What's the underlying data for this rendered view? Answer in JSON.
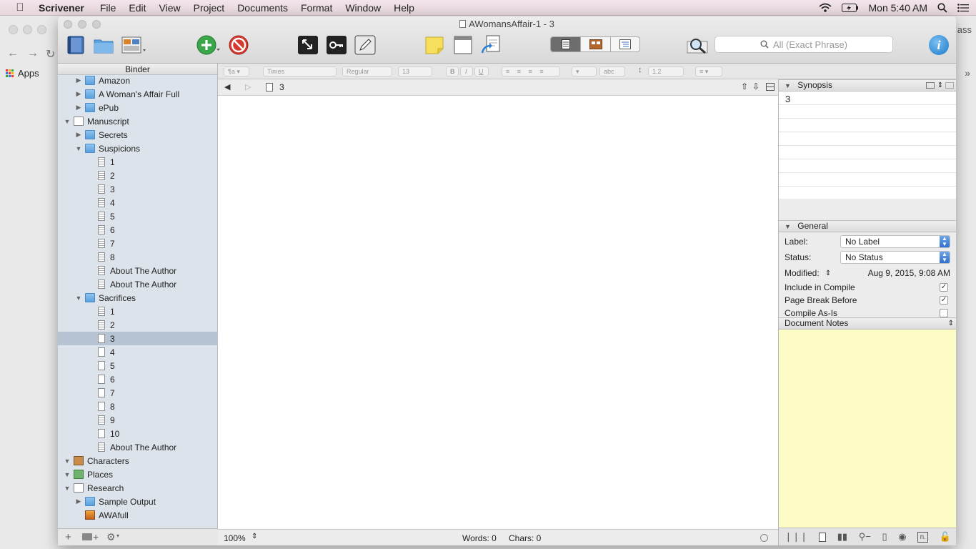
{
  "menubar": {
    "app_name": "Scrivener",
    "menus": [
      "File",
      "Edit",
      "View",
      "Project",
      "Documents",
      "Format",
      "Window",
      "Help"
    ],
    "clock": "Mon 5:40 AM"
  },
  "browser": {
    "apps_label": "Apps",
    "tab_fragment": "ass"
  },
  "window": {
    "title": "AWomansAffair-1 - 3",
    "search_placeholder": "All (Exact Phrase)"
  },
  "binder": {
    "header": "Binder",
    "items": [
      {
        "label": "Amazon",
        "level": 1,
        "icon": "folder",
        "tri": "right"
      },
      {
        "label": "A Woman's Affair Full",
        "level": 1,
        "icon": "folder",
        "tri": "right"
      },
      {
        "label": "ePub",
        "level": 1,
        "icon": "folder",
        "tri": "right"
      },
      {
        "label": "Manuscript",
        "level": 0,
        "icon": "ms",
        "tri": "down"
      },
      {
        "label": "Secrets",
        "level": 1,
        "icon": "folder",
        "tri": "right"
      },
      {
        "label": "Suspicions",
        "level": 1,
        "icon": "folder",
        "tri": "down"
      },
      {
        "label": "1",
        "level": 2,
        "icon": "doc"
      },
      {
        "label": "2",
        "level": 2,
        "icon": "doc"
      },
      {
        "label": "3",
        "level": 2,
        "icon": "doc"
      },
      {
        "label": "4",
        "level": 2,
        "icon": "doc"
      },
      {
        "label": "5",
        "level": 2,
        "icon": "doc"
      },
      {
        "label": "6",
        "level": 2,
        "icon": "doc"
      },
      {
        "label": "7",
        "level": 2,
        "icon": "doc"
      },
      {
        "label": "8",
        "level": 2,
        "icon": "doc"
      },
      {
        "label": "About The Author",
        "level": 2,
        "icon": "doc"
      },
      {
        "label": "About The Author",
        "level": 2,
        "icon": "doc"
      },
      {
        "label": "Sacrifices",
        "level": 1,
        "icon": "folder",
        "tri": "down"
      },
      {
        "label": "1",
        "level": 2,
        "icon": "doc"
      },
      {
        "label": "2",
        "level": 2,
        "icon": "doc"
      },
      {
        "label": "3",
        "level": 2,
        "icon": "blank",
        "selected": true
      },
      {
        "label": "4",
        "level": 2,
        "icon": "blank"
      },
      {
        "label": "5",
        "level": 2,
        "icon": "blank"
      },
      {
        "label": "6",
        "level": 2,
        "icon": "blank"
      },
      {
        "label": "7",
        "level": 2,
        "icon": "blank"
      },
      {
        "label": "8",
        "level": 2,
        "icon": "blank"
      },
      {
        "label": "9",
        "level": 2,
        "icon": "doc"
      },
      {
        "label": "10",
        "level": 2,
        "icon": "blank"
      },
      {
        "label": "About The Author",
        "level": 2,
        "icon": "doc"
      },
      {
        "label": "Characters",
        "level": 0,
        "icon": "char",
        "tri": "down"
      },
      {
        "label": "Places",
        "level": 0,
        "icon": "places",
        "tri": "down"
      },
      {
        "label": "Research",
        "level": 0,
        "icon": "research",
        "tri": "down"
      },
      {
        "label": "Sample Output",
        "level": 1,
        "icon": "folder",
        "tri": "right"
      },
      {
        "label": "AWAfull",
        "level": 1,
        "icon": "img"
      }
    ]
  },
  "formatbar": {
    "style": "¶a",
    "font": "Times",
    "weight": "Regular",
    "size": "13",
    "bold": "B",
    "italic": "I",
    "underline": "U",
    "highlight": "abc",
    "line_spacing": "1.2"
  },
  "editor": {
    "doc_title": "3",
    "zoom": "100%",
    "words": "Words: 0",
    "chars": "Chars: 0"
  },
  "inspector": {
    "synopsis_header": "Synopsis",
    "synopsis_text": "3",
    "general_header": "General",
    "label_caption": "Label:",
    "label_value": "No Label",
    "status_caption": "Status:",
    "status_value": "No Status",
    "modified_caption": "Modified:",
    "modified_value": "Aug 9, 2015, 9:08 AM",
    "include_compile": "Include in Compile",
    "page_break": "Page Break Before",
    "compile_as_is": "Compile As-Is",
    "notes_header": "Document Notes",
    "notes_footer_label": "n."
  },
  "colors": {
    "accent": "#2e6fd0",
    "selection": "#b6c3d3",
    "binder_bg": "#dde3ea",
    "notes_bg": "#fdfbc6"
  }
}
